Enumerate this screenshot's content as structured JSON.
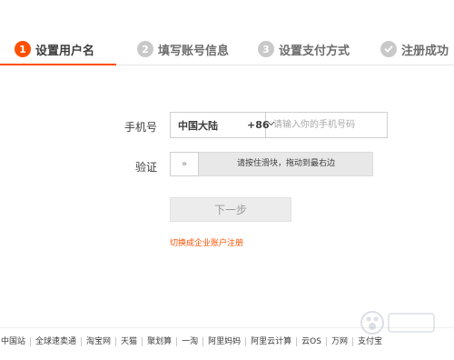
{
  "steps": [
    {
      "num": "1",
      "label": "设置用户名",
      "active": true
    },
    {
      "num": "2",
      "label": "填写账号信息",
      "active": false
    },
    {
      "num": "3",
      "label": "设置支付方式",
      "active": false
    },
    {
      "label": "注册成功",
      "active": false,
      "icon": "check-icon"
    }
  ],
  "form": {
    "phone_label": "手机号",
    "region": "中国大陆",
    "country_code": "+86",
    "phone_placeholder": "请输入你的手机号码",
    "verify_label": "验证",
    "slider_handle": "»",
    "slider_text": "请按住滑块，拖动到最右边",
    "next_label": "下一步",
    "enterprise_link": "切换成企业账户注册"
  },
  "footer": {
    "links": [
      "中国站",
      "全球速卖通",
      "淘宝网",
      "天猫",
      "聚划算",
      "一淘",
      "阿里妈妈",
      "阿里云计算",
      "云OS",
      "万网",
      "支付宝"
    ]
  },
  "colors": {
    "accent": "#ff5000",
    "step_inactive": "#c9c9c9"
  }
}
